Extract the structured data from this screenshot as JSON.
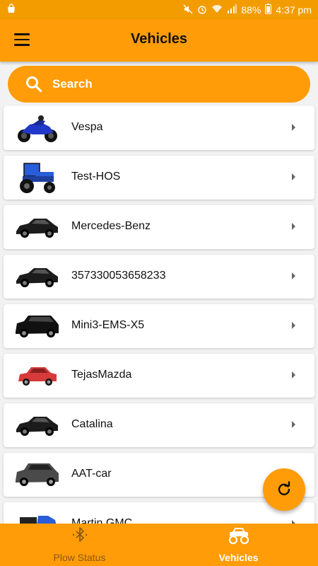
{
  "status_bar": {
    "battery": "88%",
    "time": "4:37 pm"
  },
  "header": {
    "title": "Vehicles",
    "menu_icon": "hamburger-menu-icon"
  },
  "search": {
    "label": "Search",
    "icon": "search-icon"
  },
  "vehicles": [
    {
      "name": "Vespa",
      "icon": "motorcycle-icon"
    },
    {
      "name": "Test-HOS",
      "icon": "tractor-icon"
    },
    {
      "name": "Mercedes-Benz",
      "icon": "car-icon"
    },
    {
      "name": "357330053658233",
      "icon": "car-icon"
    },
    {
      "name": "Mini3-EMS-X5",
      "icon": "suv-icon"
    },
    {
      "name": "TejasMazda",
      "icon": "car-icon"
    },
    {
      "name": "Catalina",
      "icon": "car-icon"
    },
    {
      "name": "AAT-car",
      "icon": "suv-icon"
    },
    {
      "name": "Martin GMC",
      "icon": "truck-icon"
    }
  ],
  "fab": {
    "icon": "refresh-icon"
  },
  "bottom_nav": [
    {
      "label": "Plow Status",
      "icon": "bluetooth-icon",
      "active": false
    },
    {
      "label": "Vehicles",
      "icon": "monster-truck-icon",
      "active": true
    }
  ],
  "colors": {
    "accent": "#ff9c08",
    "status_bar": "#f39c00",
    "background": "#f2f2f2"
  }
}
